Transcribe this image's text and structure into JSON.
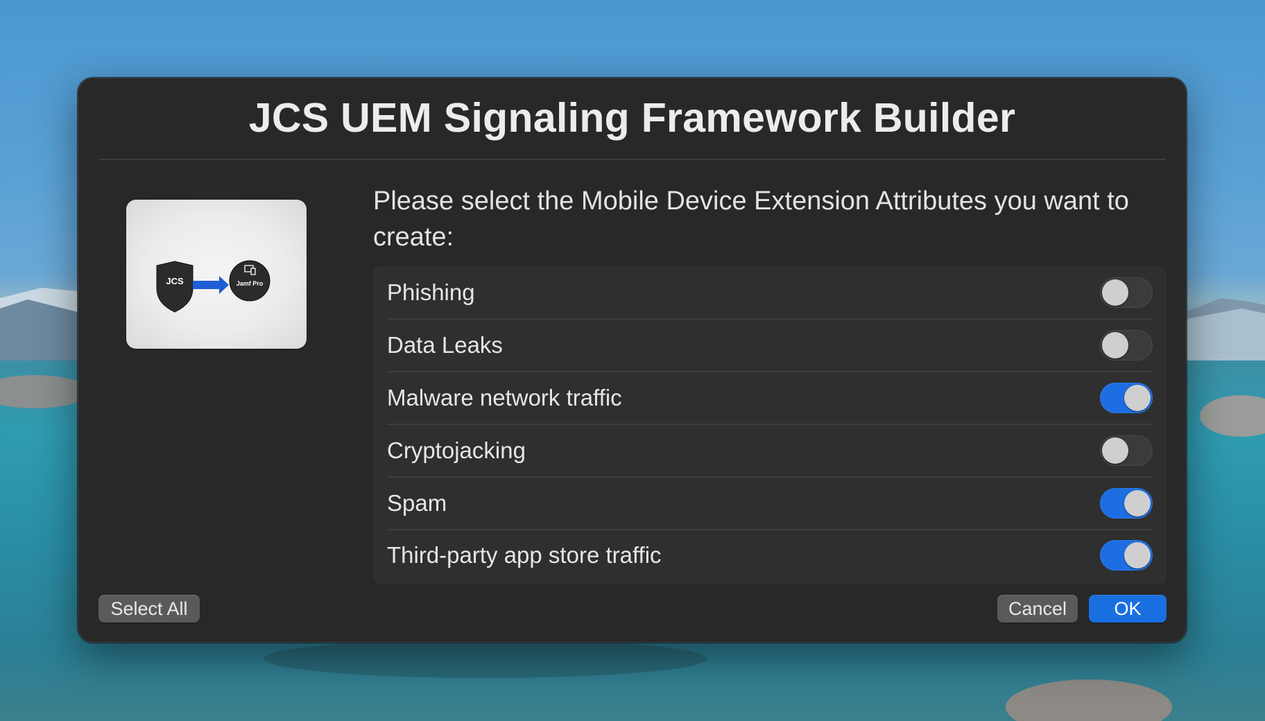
{
  "dialog": {
    "title": "JCS UEM Signaling Framework Builder",
    "prompt": "Please select the Mobile Device Extension Attributes you want to create:",
    "logo": {
      "left_text": "JCS",
      "right_text": "Jamf Pro"
    },
    "attributes": [
      {
        "label": "Phishing",
        "enabled": false
      },
      {
        "label": "Data Leaks",
        "enabled": false
      },
      {
        "label": "Malware network traffic",
        "enabled": true
      },
      {
        "label": "Cryptojacking",
        "enabled": false
      },
      {
        "label": "Spam",
        "enabled": true
      },
      {
        "label": "Third-party app store traffic",
        "enabled": true
      }
    ],
    "buttons": {
      "select_all": "Select All",
      "cancel": "Cancel",
      "ok": "OK"
    }
  },
  "colors": {
    "toggle_on": "#1d6ee3",
    "ok_button": "#1a6fe0",
    "dialog_bg": "#282828"
  }
}
